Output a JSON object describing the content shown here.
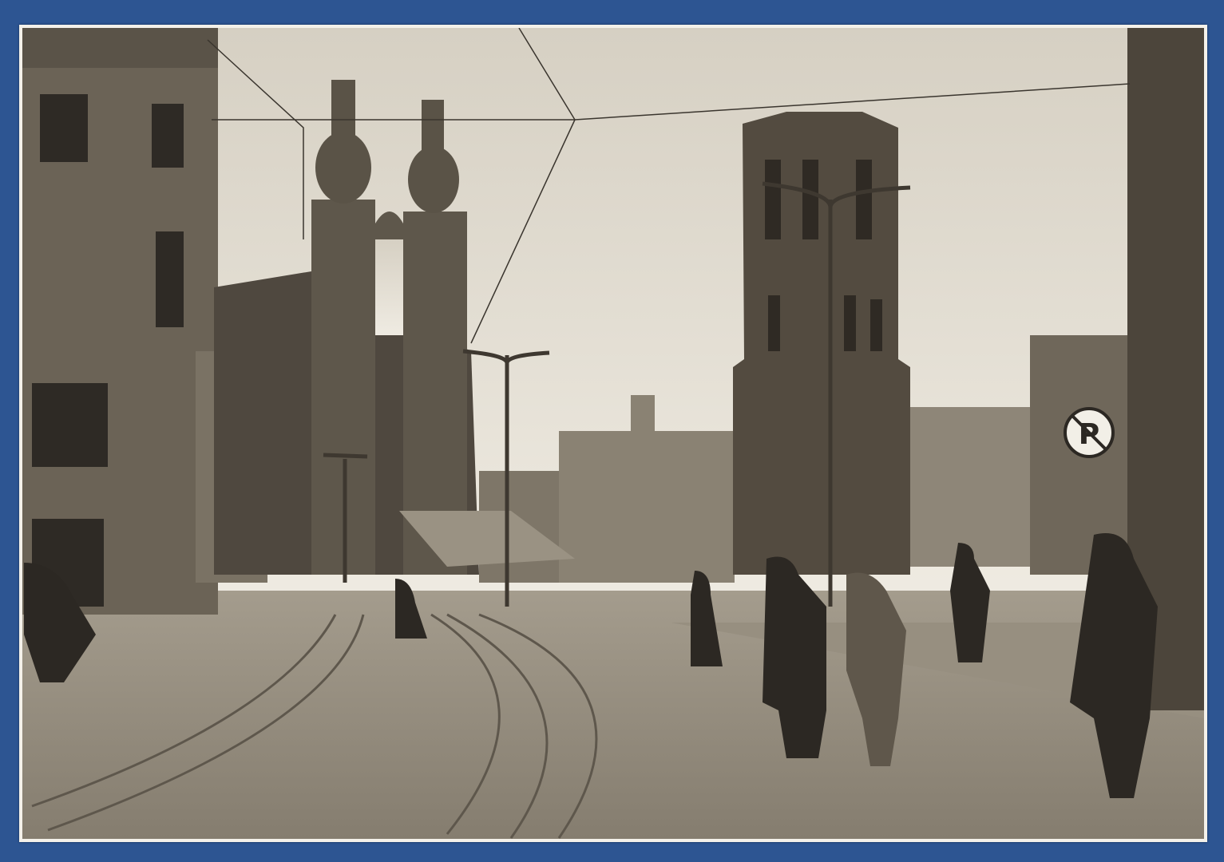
{
  "photo": {
    "colors": {
      "background": "#2d5592",
      "card": "#f4f1ea",
      "sky_top": "#d9d3c6",
      "sky_bottom": "#eeeae1",
      "building_dark": "#4a4238",
      "building_mid": "#6e6658",
      "street": "#8c8475"
    }
  },
  "sign": {
    "parking_letter": "P"
  }
}
